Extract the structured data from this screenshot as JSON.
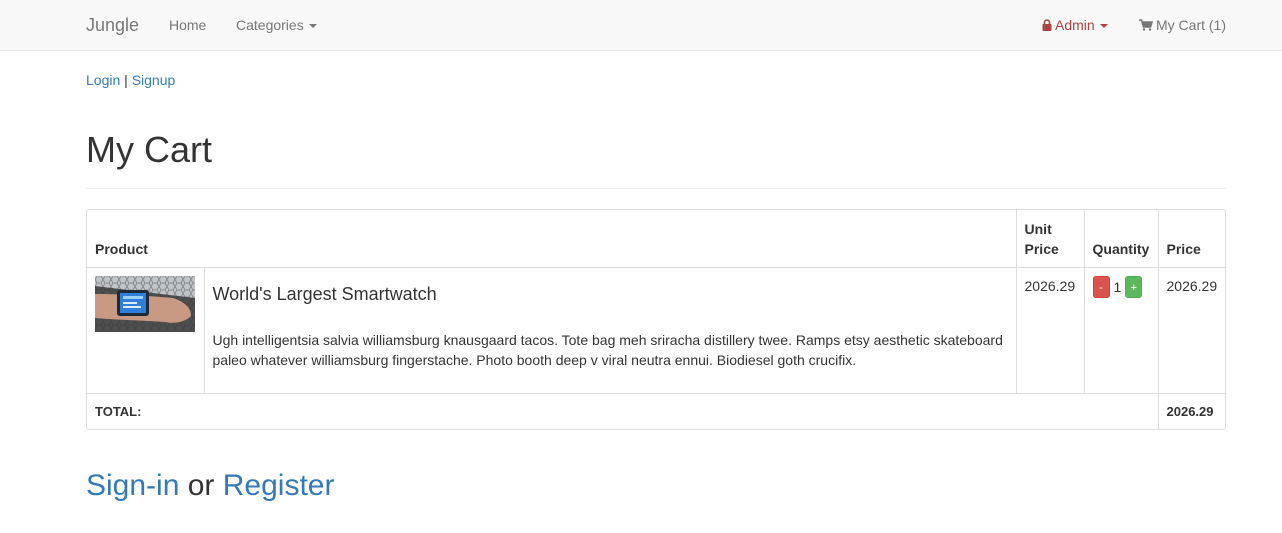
{
  "navbar": {
    "brand": "Jungle",
    "home": "Home",
    "categories": "Categories",
    "admin": "Admin",
    "cart": "My Cart (1)"
  },
  "auth": {
    "login": "Login",
    "separator": "|",
    "signup": "Signup"
  },
  "page": {
    "title": "My Cart"
  },
  "table": {
    "headers": {
      "product": "Product",
      "unit_price": "Unit Price",
      "quantity": "Quantity",
      "price": "Price"
    },
    "items": [
      {
        "name": "World's Largest Smartwatch",
        "description": "Ugh intelligentsia salvia williamsburg knausgaard tacos. Tote bag meh sriracha distillery twee. Ramps etsy aesthetic skateboard paleo whatever williamsburg fingerstache. Photo booth deep v viral neutra ennui. Biodiesel goth crucifix.",
        "unit_price": "2026.29",
        "quantity": "1",
        "minus_label": "-",
        "plus_label": "+",
        "price": "2026.29"
      }
    ],
    "total_label": "TOTAL:",
    "total_value": "2026.29"
  },
  "footer_auth": {
    "signin": "Sign-in",
    "or": "or",
    "register": "Register"
  },
  "colors": {
    "link": "#337ab7",
    "admin": "#a94442",
    "danger": "#d9534f",
    "success": "#5cb85c"
  }
}
